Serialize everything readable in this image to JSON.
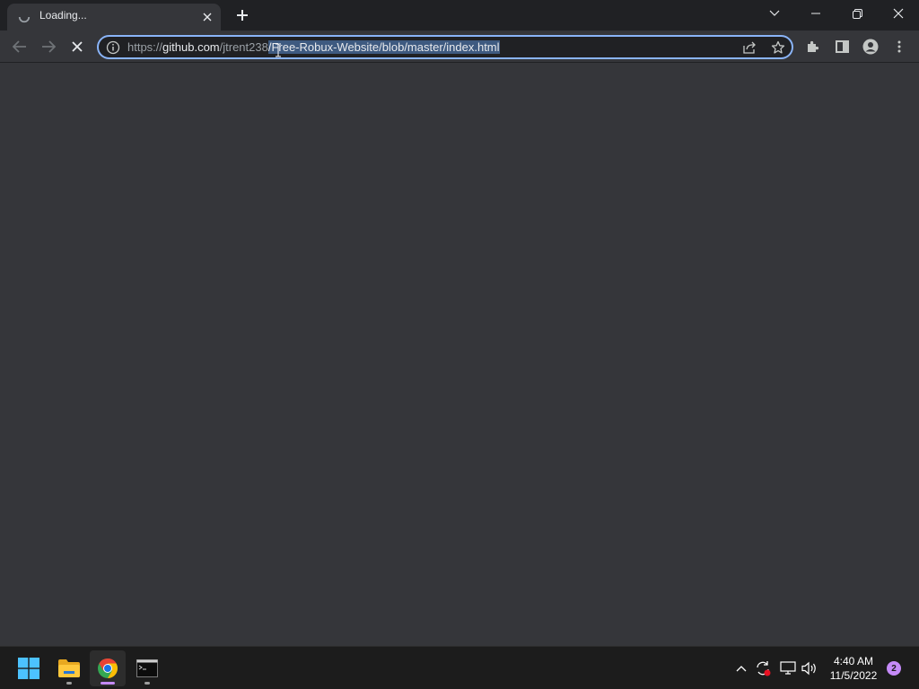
{
  "tab": {
    "title": "Loading...",
    "spinner_icon": "loading-spinner-icon",
    "close_icon": "close-icon"
  },
  "new_tab": {
    "icon": "plus-icon"
  },
  "window_controls": {
    "tab_search_icon": "chevron-down-icon",
    "minimize_icon": "minimize-icon",
    "restore_icon": "restore-icon",
    "close_icon": "close-icon"
  },
  "toolbar": {
    "back_icon": "arrow-left-icon",
    "forward_icon": "arrow-right-icon",
    "stop_icon": "close-icon",
    "extensions_icon": "puzzle-icon",
    "side_panel_icon": "side-panel-icon",
    "profile_icon": "person-icon",
    "menu_icon": "kebab-menu-icon"
  },
  "omnibox": {
    "scheme": "https://",
    "host": "github.com",
    "path_unselected": "/jtrent238",
    "path_selected": "/Free-Robux-Website/blob/master/index.html",
    "info_icon": "info-icon",
    "share_icon": "share-icon",
    "bookmark_icon": "star-icon"
  },
  "taskbar": {
    "start_icon": "windows-icon",
    "apps": [
      "file-explorer-icon",
      "chrome-icon",
      "terminal-icon"
    ],
    "tray": [
      "chevron-up-icon",
      "sync-icon",
      "network-icon",
      "volume-icon"
    ],
    "time": "4:40 AM",
    "date": "11/5/2022",
    "notification_count": "2"
  },
  "colors": {
    "accent": "#8ab4f8",
    "selection": "#3e5a80",
    "background": "#35363a",
    "frame": "#202124",
    "taskbar": "#1c1c1c"
  }
}
